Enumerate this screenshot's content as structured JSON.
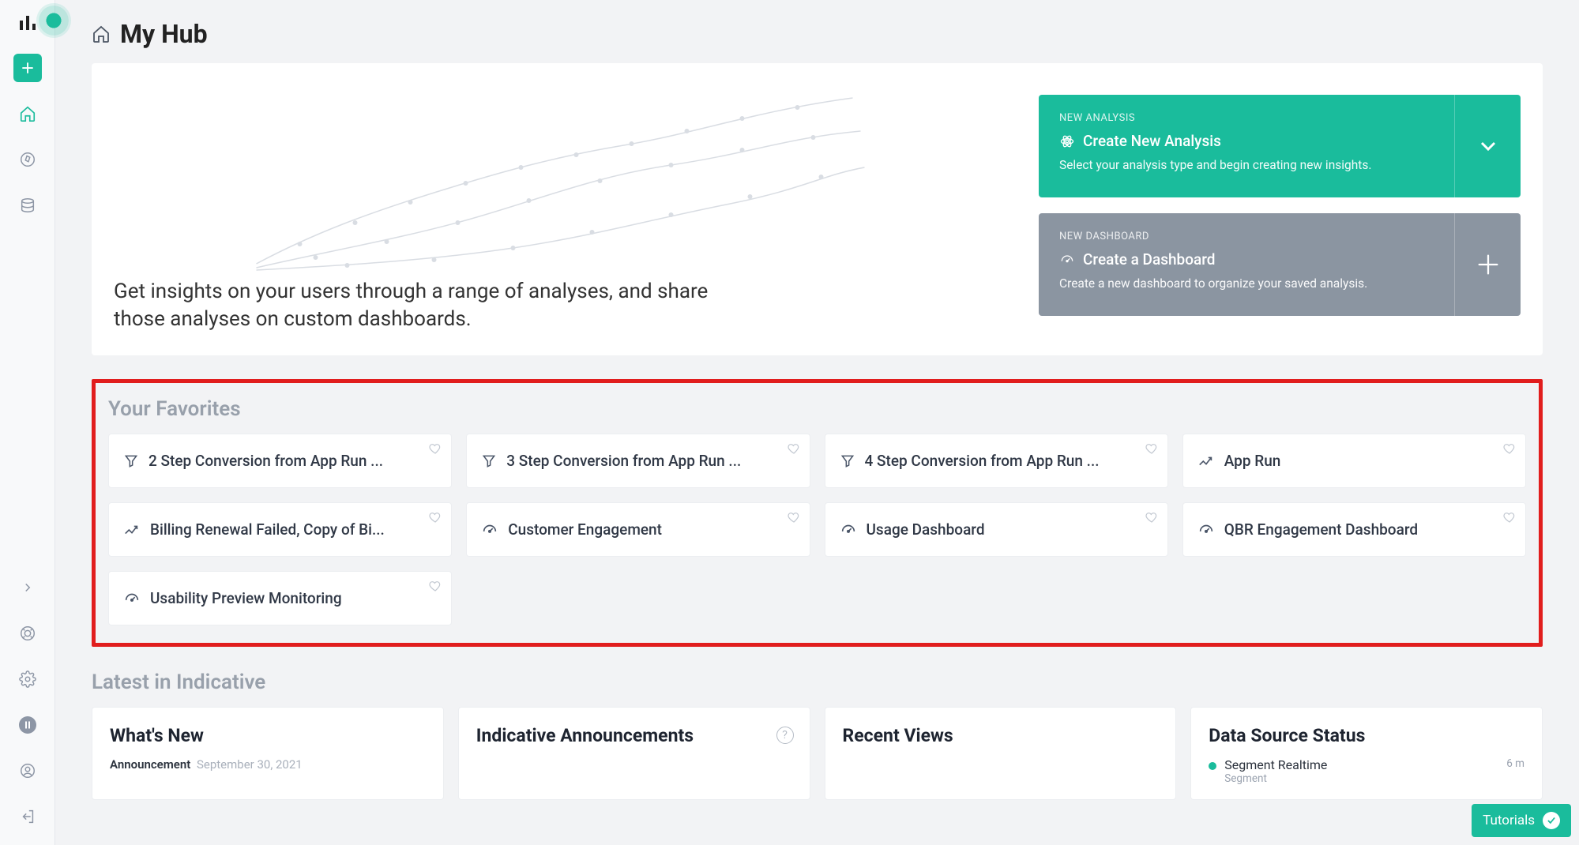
{
  "page": {
    "title": "My Hub",
    "hero_description": "Get insights on your users through a range of analyses, and share those analyses on custom dashboards."
  },
  "sidebar": {
    "items": [
      "create",
      "home",
      "explore",
      "data"
    ]
  },
  "cta_analysis": {
    "eyebrow": "NEW ANALYSIS",
    "title": "Create New Analysis",
    "subtitle": "Select your analysis type and begin creating new insights."
  },
  "cta_dashboard": {
    "eyebrow": "NEW DASHBOARD",
    "title": "Create a Dashboard",
    "subtitle": "Create a new dashboard to organize your saved analysis."
  },
  "favorites": {
    "heading": "Your Favorites",
    "items": [
      {
        "title": "2 Step Conversion from App Run ...",
        "icon": "funnel"
      },
      {
        "title": "3 Step Conversion from App Run ...",
        "icon": "funnel"
      },
      {
        "title": "4 Step Conversion from App Run ...",
        "icon": "funnel"
      },
      {
        "title": "App Run",
        "icon": "trend"
      },
      {
        "title": "Billing Renewal Failed, Copy of Bi...",
        "icon": "trend"
      },
      {
        "title": "Customer Engagement",
        "icon": "gauge"
      },
      {
        "title": "Usage Dashboard",
        "icon": "gauge"
      },
      {
        "title": "QBR Engagement Dashboard",
        "icon": "gauge"
      },
      {
        "title": "Usability Preview Monitoring",
        "icon": "gauge"
      }
    ]
  },
  "latest": {
    "heading": "Latest in Indicative",
    "panels": {
      "whats_new": {
        "title": "What's New",
        "item_label": "Announcement",
        "item_date": "September 30, 2021"
      },
      "announcements": {
        "title": "Indicative Announcements"
      },
      "recent": {
        "title": "Recent Views"
      },
      "datasources": {
        "title": "Data Source Status",
        "items": [
          {
            "name": "Segment Realtime",
            "provider": "Segment",
            "age": "6 m"
          }
        ]
      }
    }
  },
  "tutorials_label": "Tutorials",
  "colors": {
    "accent": "#1abc9c",
    "muted": "#8d96a5",
    "danger_frame": "#e11d1d"
  }
}
